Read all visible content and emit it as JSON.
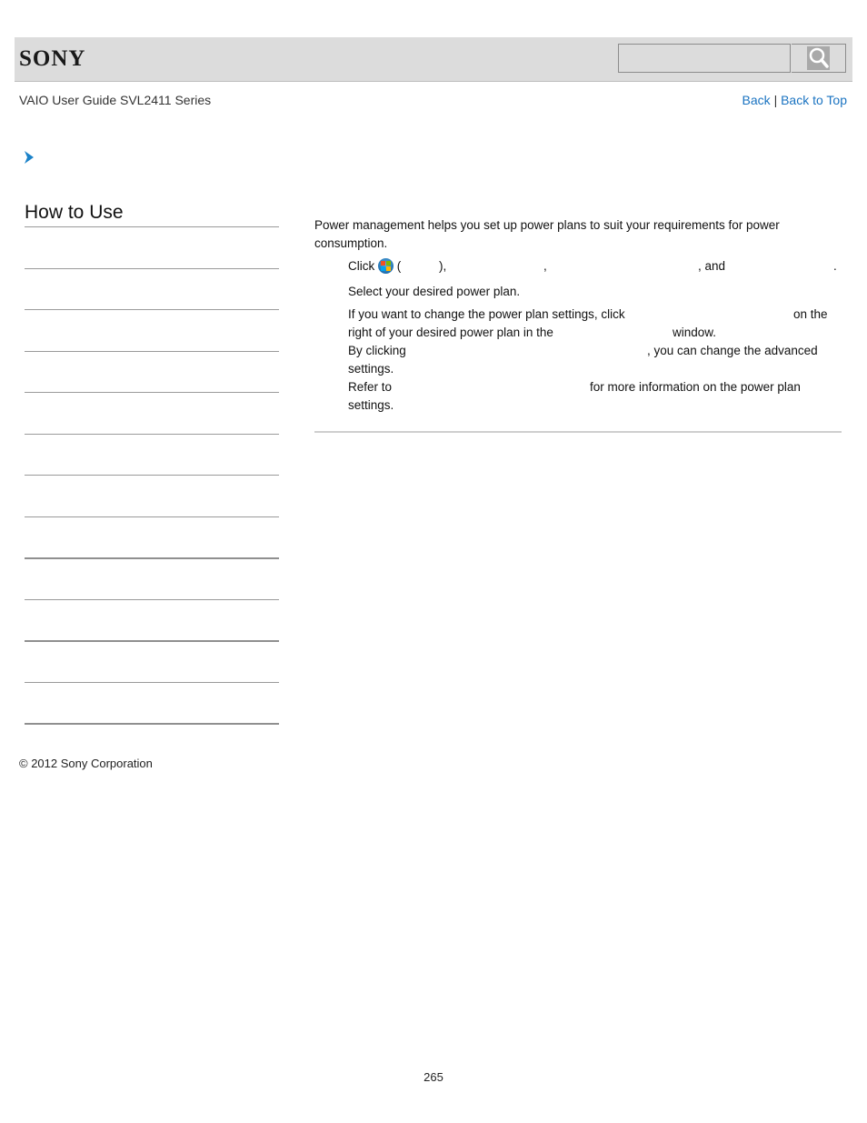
{
  "header": {
    "brand": "SONY",
    "search": {
      "placeholder": "",
      "value": ""
    },
    "search_button_icon": "search-icon"
  },
  "nav": {
    "guide_title": "VAIO User Guide SVL2411 Series",
    "back_label": "Back",
    "separator": "|",
    "back_to_top_label": "Back to Top"
  },
  "breadcrumb": {
    "icon": "chevron-right-icon"
  },
  "sidebar": {
    "title": "How to Use",
    "item_count": 12
  },
  "content": {
    "intro": "Power management helps you set up power plans to suit your requirements for power consumption.",
    "step1": {
      "prefix": "Click",
      "open_paren": "(",
      "close_paren": "),",
      "comma": ",",
      "and": ", and",
      "period": "."
    },
    "step2": "Select your desired power plan.",
    "note1": {
      "line1_start": "If you want to change the power plan settings, click",
      "line1_end": "on the",
      "line2_start": "right of your desired power plan in the",
      "line2_end": "window."
    },
    "note2": {
      "line1_start": "By clicking",
      "line1_end": ", you can change the advanced",
      "line2": "settings."
    },
    "note3": {
      "line1_start": "Refer to",
      "line1_end": "for more information on the power plan",
      "line2": "settings."
    }
  },
  "footer": {
    "copyright": "© 2012 Sony Corporation",
    "page_number": "265"
  }
}
